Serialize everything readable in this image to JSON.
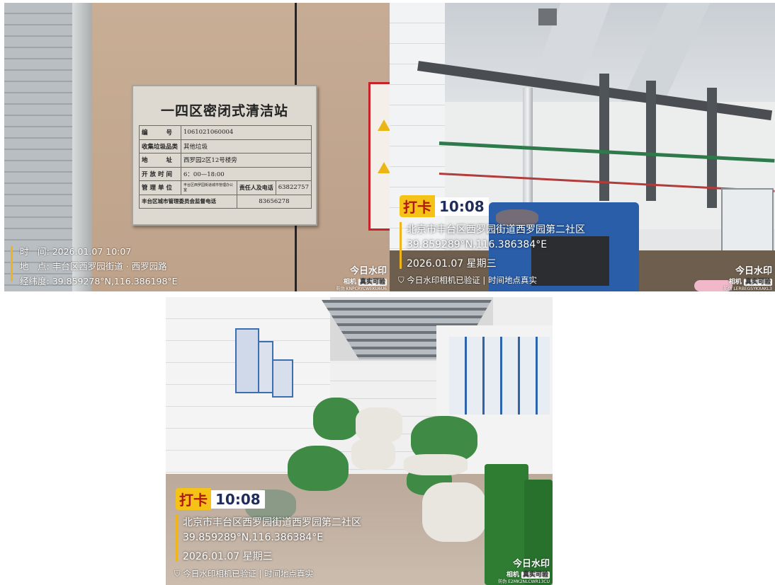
{
  "photo1": {
    "plaque": {
      "title": "一四区密闭式清洁站",
      "rows": [
        {
          "key": "编　　号",
          "value": "1061021060004"
        },
        {
          "key": "收集垃圾品类",
          "value": "其他垃圾"
        },
        {
          "key": "地　　址",
          "value": "西罗园2区12号楼旁"
        },
        {
          "key": "开放时间",
          "value": "6：00—18:00"
        },
        {
          "key": "管理单位",
          "value": "丰台区西罗园街道城市管理办公室",
          "extra_key": "责任人及电话",
          "extra_value": "63822757"
        },
        {
          "key": "丰台区城市管理委员会监督电话",
          "value": "83656278"
        }
      ]
    },
    "watermark": {
      "time_label": "时　间:",
      "time_value": "2026.01.07 10:07",
      "place_label": "地　点:",
      "place_value": "丰台区西罗园街道 · 西罗园路",
      "coord_label": "经纬度:",
      "coord_value": "39.859278°N,116.386198°E"
    },
    "brand": {
      "title": "今日水印",
      "sub_a": "相机",
      "sub_b": "真实可验"
    },
    "code": "防伪 KNPCRYCWEKU6U6"
  },
  "photo2": {
    "clock_tag": "打卡",
    "clock_time": "10:08",
    "location": "北京市丰台区西罗园街道西罗园第二社区",
    "coords": "39.859289°N,116.386384°E",
    "date": "2026.01.07 星期三",
    "verify": "今日水印相机已验证 | 时间地点真实",
    "brand": {
      "title": "今日水印",
      "sub_a": "相机",
      "sub_b": "真实可验"
    },
    "code": "防伪 LERBEGSYKXAKL3"
  },
  "photo3": {
    "clock_tag": "打卡",
    "clock_time": "10:08",
    "location": "北京市丰台区西罗园街道西罗园第二社区",
    "coords": "39.859289°N,116.386384°E",
    "date": "2026.01.07 星期三",
    "verify": "今日水印相机已验证 | 时间地点真实",
    "brand": {
      "title": "今日水印",
      "sub_a": "相机",
      "sub_b": "真实可验"
    },
    "code": "防伪 E2MK2NLCWR13CU"
  },
  "colors": {
    "accent_yellow": "#f5c218",
    "bin_green": "#2e7d32",
    "compactor_blue": "#2a5ea8"
  }
}
